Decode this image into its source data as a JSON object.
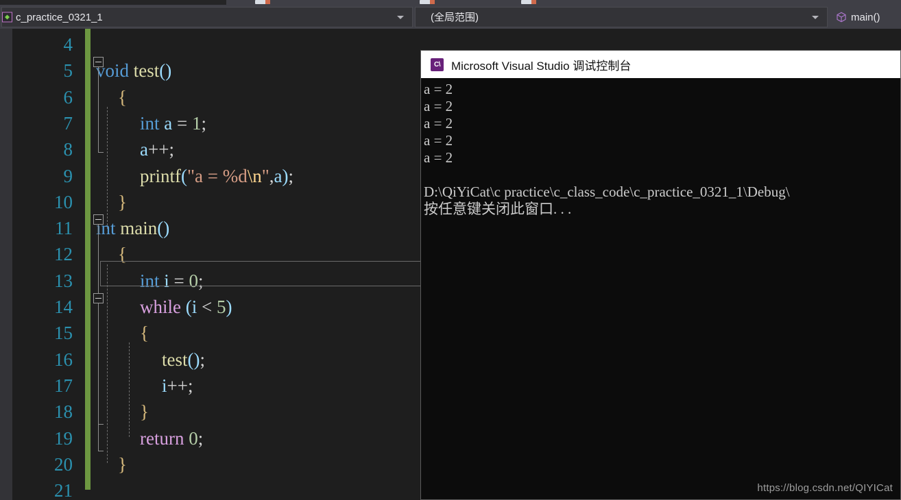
{
  "navbar": {
    "project": "c_practice_0321_1",
    "project_icon": "project-file-icon",
    "scope": "(全局范围)",
    "scope_placeholder": "(全局范围)",
    "member": "main()",
    "member_icon": "method-cube-icon",
    "dropdown_icon": "chevron-down-icon"
  },
  "editor": {
    "language": "c",
    "change_bar_color": "#6d9741",
    "line_number_color": "#2b91af",
    "background": "#1e1e1e",
    "current_line": 13,
    "lines": [
      {
        "num": "4",
        "tokens": []
      },
      {
        "num": "5",
        "tokens": [
          {
            "t": "void",
            "c": "kw"
          },
          {
            "t": " ",
            "c": "pun"
          },
          {
            "t": "test",
            "c": "fn"
          },
          {
            "t": "()",
            "c": "par"
          }
        ]
      },
      {
        "num": "6",
        "tokens": [
          {
            "t": "{",
            "c": "brc"
          }
        ]
      },
      {
        "num": "7",
        "tokens": [
          {
            "t": "int",
            "c": "kw"
          },
          {
            "t": " ",
            "c": "pun"
          },
          {
            "t": "a",
            "c": "var"
          },
          {
            "t": " = ",
            "c": "pun"
          },
          {
            "t": "1",
            "c": "num"
          },
          {
            "t": ";",
            "c": "pun"
          }
        ]
      },
      {
        "num": "8",
        "tokens": [
          {
            "t": "a",
            "c": "var"
          },
          {
            "t": "++;",
            "c": "pun"
          }
        ]
      },
      {
        "num": "9",
        "tokens": [
          {
            "t": "printf",
            "c": "fn"
          },
          {
            "t": "(",
            "c": "par"
          },
          {
            "t": "\"a = %d",
            "c": "str"
          },
          {
            "t": "\\n",
            "c": "esc"
          },
          {
            "t": "\"",
            "c": "str"
          },
          {
            "t": ",",
            "c": "pun"
          },
          {
            "t": "a",
            "c": "var"
          },
          {
            "t": ")",
            "c": "par"
          },
          {
            "t": ";",
            "c": "pun"
          }
        ]
      },
      {
        "num": "10",
        "tokens": [
          {
            "t": "}",
            "c": "brc"
          }
        ]
      },
      {
        "num": "11",
        "tokens": [
          {
            "t": "int",
            "c": "kw"
          },
          {
            "t": " ",
            "c": "pun"
          },
          {
            "t": "main",
            "c": "fn"
          },
          {
            "t": "()",
            "c": "par"
          }
        ]
      },
      {
        "num": "12",
        "tokens": [
          {
            "t": "{",
            "c": "brc"
          }
        ]
      },
      {
        "num": "13",
        "tokens": [
          {
            "t": "int",
            "c": "kw"
          },
          {
            "t": " ",
            "c": "pun"
          },
          {
            "t": "i",
            "c": "var"
          },
          {
            "t": " = ",
            "c": "pun"
          },
          {
            "t": "0",
            "c": "num"
          },
          {
            "t": ";",
            "c": "pun"
          }
        ]
      },
      {
        "num": "14",
        "tokens": [
          {
            "t": "while",
            "c": "ctl"
          },
          {
            "t": " ",
            "c": "pun"
          },
          {
            "t": "(",
            "c": "par"
          },
          {
            "t": "i",
            "c": "var"
          },
          {
            "t": " < ",
            "c": "pun"
          },
          {
            "t": "5",
            "c": "num"
          },
          {
            "t": ")",
            "c": "par"
          }
        ]
      },
      {
        "num": "15",
        "tokens": [
          {
            "t": "{",
            "c": "brc"
          }
        ]
      },
      {
        "num": "16",
        "tokens": [
          {
            "t": "test",
            "c": "fn"
          },
          {
            "t": "()",
            "c": "par"
          },
          {
            "t": ";",
            "c": "pun"
          }
        ]
      },
      {
        "num": "17",
        "tokens": [
          {
            "t": "i",
            "c": "var"
          },
          {
            "t": "++;",
            "c": "pun"
          }
        ]
      },
      {
        "num": "18",
        "tokens": [
          {
            "t": "}",
            "c": "brc"
          }
        ]
      },
      {
        "num": "19",
        "tokens": [
          {
            "t": "return",
            "c": "ctl"
          },
          {
            "t": " ",
            "c": "pun"
          },
          {
            "t": "0",
            "c": "num"
          },
          {
            "t": ";",
            "c": "pun"
          }
        ]
      },
      {
        "num": "20",
        "tokens": [
          {
            "t": "}",
            "c": "brc"
          }
        ]
      },
      {
        "num": "21",
        "tokens": []
      }
    ],
    "indents": [
      0,
      0,
      1,
      2,
      2,
      2,
      1,
      0,
      1,
      2,
      2,
      2,
      3,
      3,
      2,
      2,
      1,
      0
    ]
  },
  "console": {
    "title": "Microsoft Visual Studio 调试控制台",
    "title_icon": "cpp-console-icon",
    "output": [
      "a = 2",
      "a = 2",
      "a = 2",
      "a = 2",
      "a = 2",
      "",
      "D:\\QiYiCat\\c practice\\c_class_code\\c_practice_0321_1\\Debug\\",
      "按任意键关闭此窗口. . ."
    ]
  },
  "watermark": {
    "text": "https://blog.csdn.net/QIYICat"
  }
}
